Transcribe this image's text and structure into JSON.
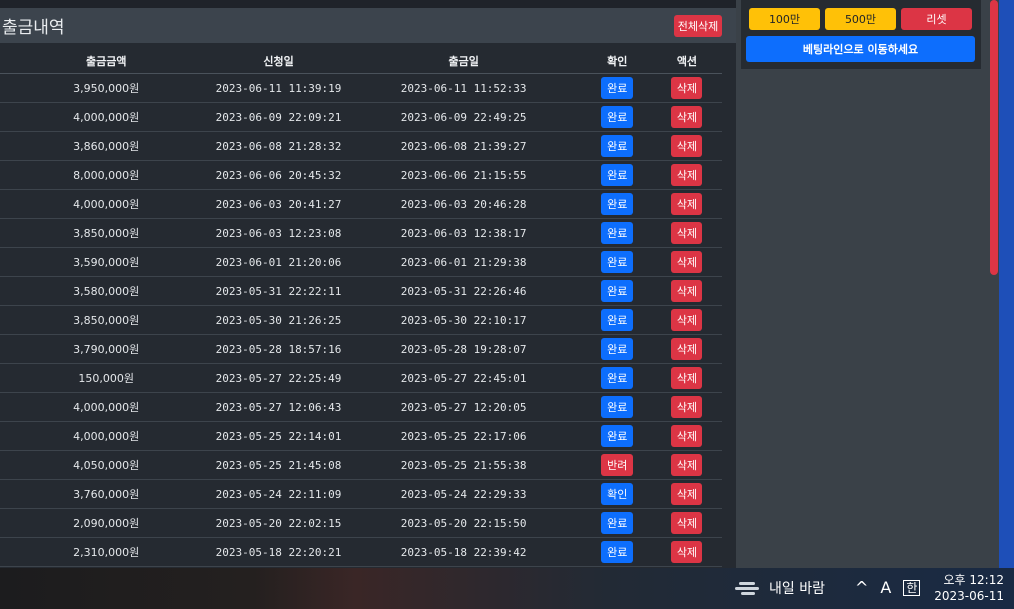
{
  "panel": {
    "title": "출금내역",
    "clear_all_label": "전체삭제"
  },
  "table": {
    "headers": [
      "출금금액",
      "신청일",
      "출금일",
      "확인",
      "액션"
    ],
    "rows": [
      {
        "amount": "3,950,000원",
        "requested": "2023-06-11 11:39:19",
        "paid": "2023-06-11 11:52:33",
        "status": "완료",
        "action": "삭제"
      },
      {
        "amount": "4,000,000원",
        "requested": "2023-06-09 22:09:21",
        "paid": "2023-06-09 22:49:25",
        "status": "완료",
        "action": "삭제"
      },
      {
        "amount": "3,860,000원",
        "requested": "2023-06-08 21:28:32",
        "paid": "2023-06-08 21:39:27",
        "status": "완료",
        "action": "삭제"
      },
      {
        "amount": "8,000,000원",
        "requested": "2023-06-06 20:45:32",
        "paid": "2023-06-06 21:15:55",
        "status": "완료",
        "action": "삭제"
      },
      {
        "amount": "4,000,000원",
        "requested": "2023-06-03 20:41:27",
        "paid": "2023-06-03 20:46:28",
        "status": "완료",
        "action": "삭제"
      },
      {
        "amount": "3,850,000원",
        "requested": "2023-06-03 12:23:08",
        "paid": "2023-06-03 12:38:17",
        "status": "완료",
        "action": "삭제"
      },
      {
        "amount": "3,590,000원",
        "requested": "2023-06-01 21:20:06",
        "paid": "2023-06-01 21:29:38",
        "status": "완료",
        "action": "삭제"
      },
      {
        "amount": "3,580,000원",
        "requested": "2023-05-31 22:22:11",
        "paid": "2023-05-31 22:26:46",
        "status": "완료",
        "action": "삭제"
      },
      {
        "amount": "3,850,000원",
        "requested": "2023-05-30 21:26:25",
        "paid": "2023-05-30 22:10:17",
        "status": "완료",
        "action": "삭제"
      },
      {
        "amount": "3,790,000원",
        "requested": "2023-05-28 18:57:16",
        "paid": "2023-05-28 19:28:07",
        "status": "완료",
        "action": "삭제"
      },
      {
        "amount": "150,000원",
        "requested": "2023-05-27 22:25:49",
        "paid": "2023-05-27 22:45:01",
        "status": "완료",
        "action": "삭제"
      },
      {
        "amount": "4,000,000원",
        "requested": "2023-05-27 12:06:43",
        "paid": "2023-05-27 12:20:05",
        "status": "완료",
        "action": "삭제"
      },
      {
        "amount": "4,000,000원",
        "requested": "2023-05-25 22:14:01",
        "paid": "2023-05-25 22:17:06",
        "status": "완료",
        "action": "삭제"
      },
      {
        "amount": "4,050,000원",
        "requested": "2023-05-25 21:45:08",
        "paid": "2023-05-25 21:55:38",
        "status": "반려",
        "action": "삭제"
      },
      {
        "amount": "3,760,000원",
        "requested": "2023-05-24 22:11:09",
        "paid": "2023-05-24 22:29:33",
        "status": "확인",
        "action": "삭제"
      },
      {
        "amount": "2,090,000원",
        "requested": "2023-05-20 22:02:15",
        "paid": "2023-05-20 22:15:50",
        "status": "완료",
        "action": "삭제"
      },
      {
        "amount": "2,310,000원",
        "requested": "2023-05-18 22:20:21",
        "paid": "2023-05-18 22:39:42",
        "status": "완료",
        "action": "삭제"
      }
    ]
  },
  "bet_panel": {
    "amounts": [
      "100만",
      "500만"
    ],
    "reset_label": "리셋",
    "goto_label": "베팅라인으로 이동하세요"
  },
  "taskbar": {
    "weather_text": "내일 바람",
    "ime_label": "A",
    "han_label": "한",
    "time": "오후 12:12",
    "date": "2023-06-11"
  },
  "colors": {
    "primary": "#0d6efd",
    "danger": "#dc3545",
    "warning": "#ffc107"
  }
}
